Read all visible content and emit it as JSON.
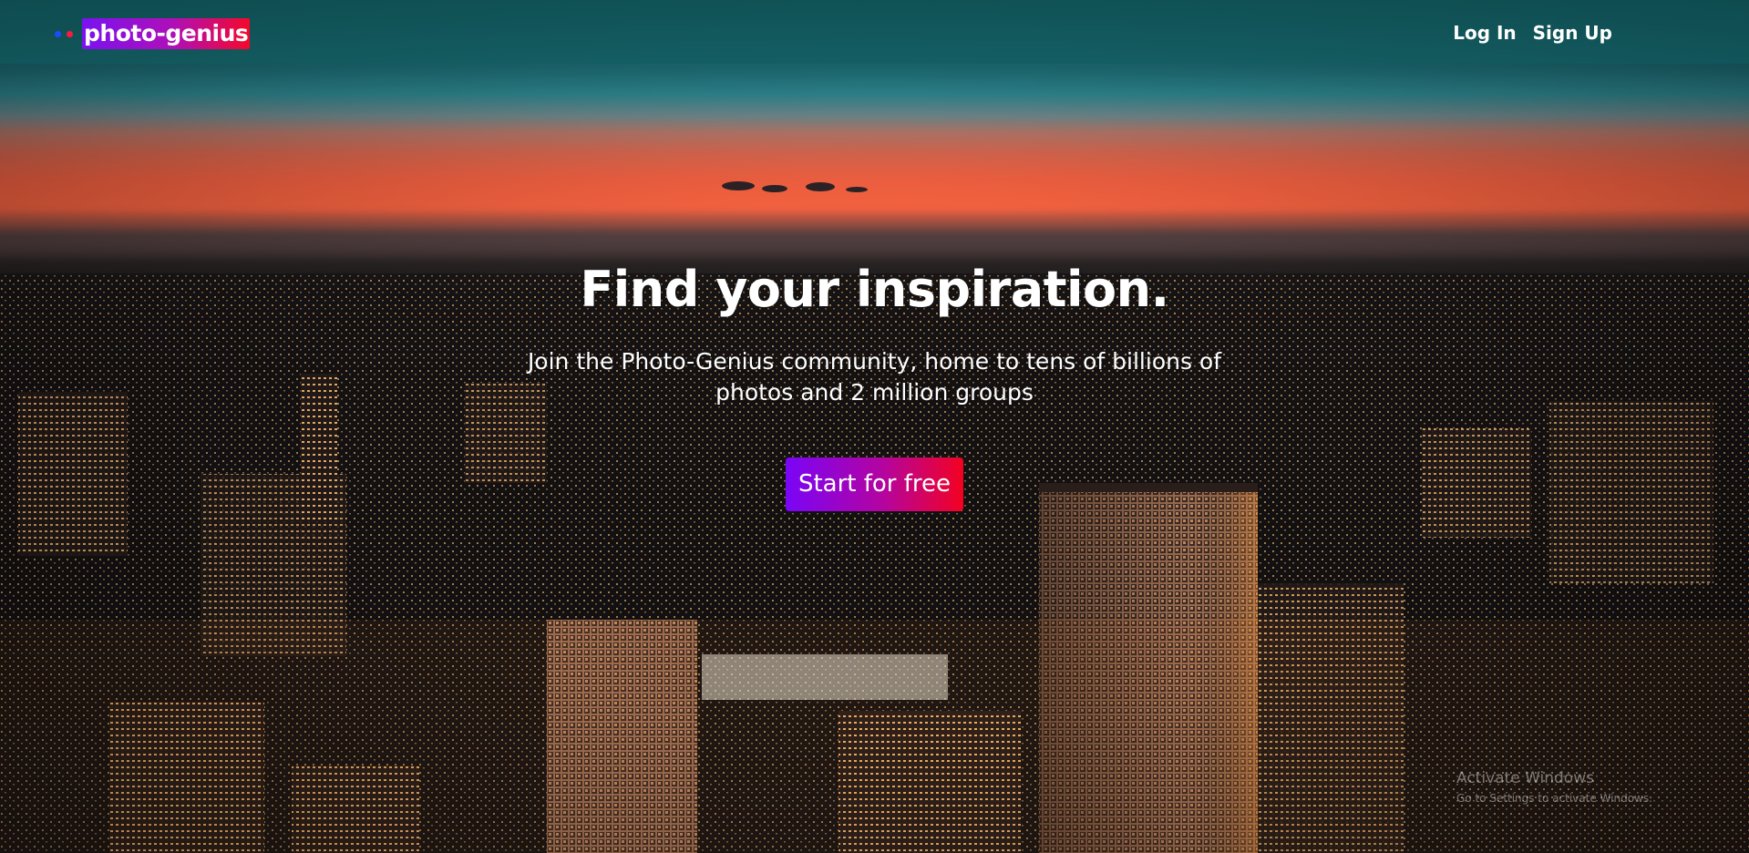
{
  "header": {
    "brand": "photo-genius",
    "nav": {
      "login": "Log In",
      "signup": "Sign Up"
    }
  },
  "hero": {
    "title": "Find your inspiration.",
    "subtitle": "Join the Photo-Genius community, home to tens of billions of photos and 2 million groups",
    "cta": "Start for free"
  },
  "watermark": {
    "title": "Activate Windows",
    "subtitle": "Go to Settings to activate Windows."
  },
  "colors": {
    "brand_gradient_start": "#7a12f0",
    "brand_gradient_end": "#f5082a",
    "topbar": "#105c60",
    "sky_orange": "#ef5f40"
  }
}
